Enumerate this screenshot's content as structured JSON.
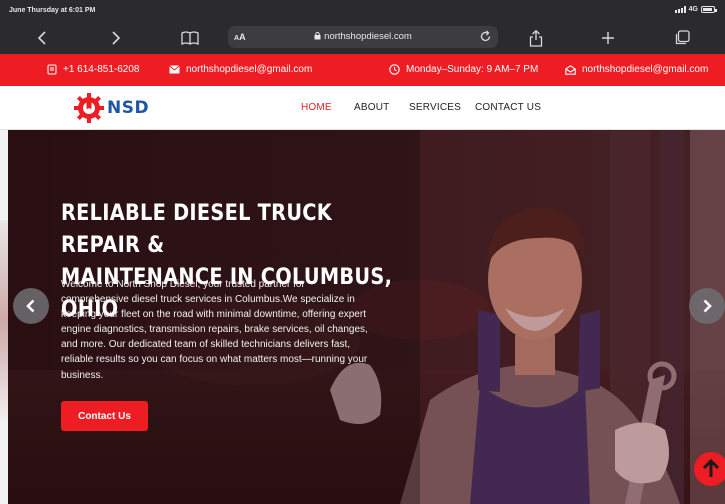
{
  "status_bar": {
    "time": "June Thursday at 6:01 PM",
    "network": "4G"
  },
  "browser": {
    "aa_label": "AA",
    "url": "northshopdiesel.com",
    "icons": [
      "chevron-left-icon",
      "chevron-right-icon",
      "book-icon",
      "lock-icon",
      "reload-icon",
      "share-icon",
      "plus-icon",
      "tabs-icon"
    ]
  },
  "info_bar": {
    "phone": "+1 614-851-6208",
    "email": "northshopdiesel@gmail.com",
    "hours": "Monday–Sunday: 9 AM–7 PM",
    "email2": "northshopdiesel@gmail.com"
  },
  "nav": {
    "logo_text": "NSD",
    "links": [
      "HOME",
      "ABOUT",
      "SERVICES",
      "CONTACT US"
    ],
    "active": "HOME"
  },
  "hero": {
    "title_line1": "RELIABLE DIESEL TRUCK REPAIR &",
    "title_line2": "MAINTENANCE IN COLUMBUS, OHIO",
    "description": "Welcome to North Shop Diesel, your trusted partner for comprehensive diesel truck services in Columbus.We specialize in keeping your fleet on the road with minimal downtime, offering expert engine diagnostics, transmission repairs, brake services, oil changes, and more. Our dedicated team of skilled technicians delivers fast, reliable results so you can focus on what matters most—running your business.",
    "cta_label": "Contact Us"
  },
  "colors": {
    "brand_red": "#ee1c23",
    "logo_blue": "#1f57a5",
    "toolbar": "#2b2b2d"
  }
}
